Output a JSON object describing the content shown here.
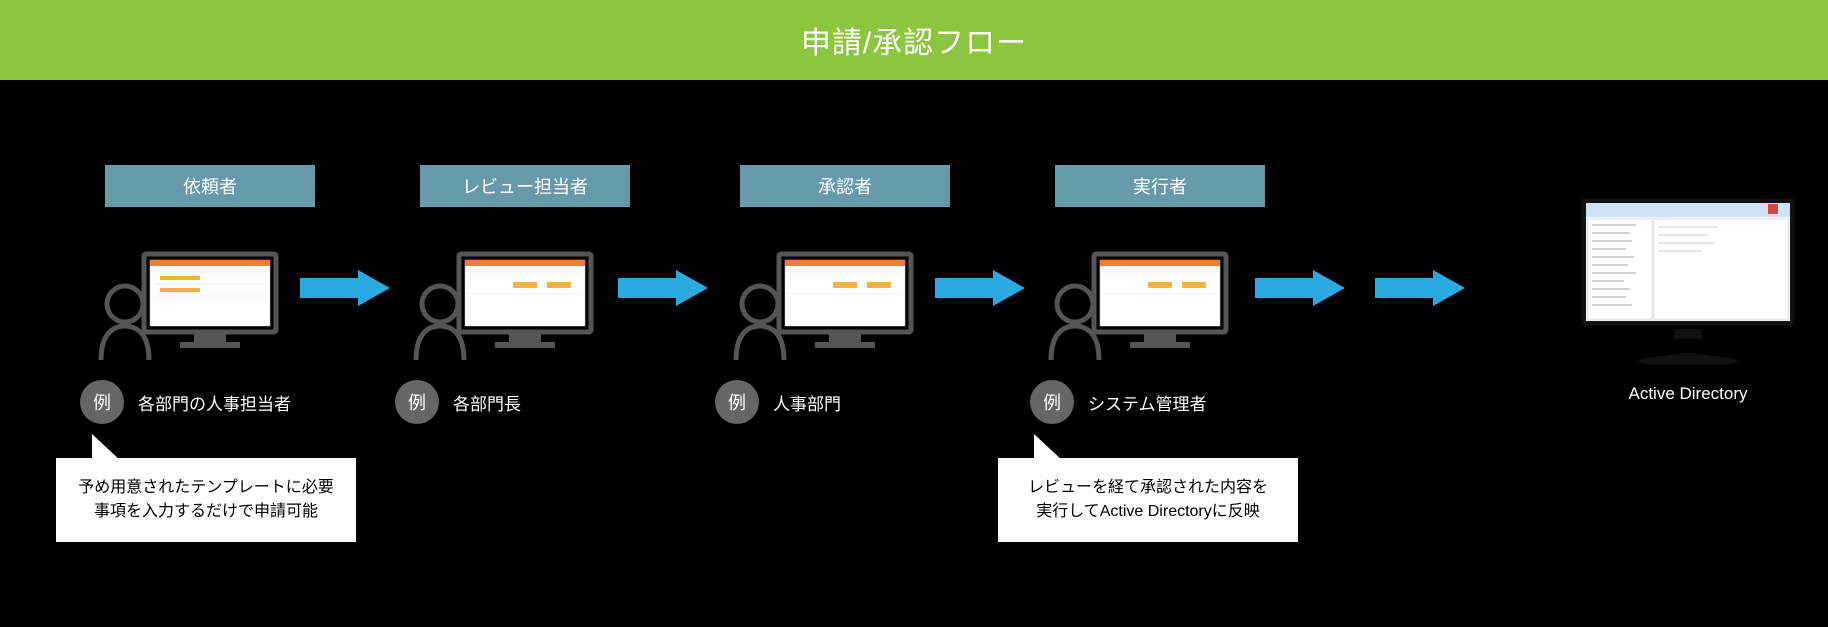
{
  "banner": {
    "title": "申請/承認フロー"
  },
  "stages": [
    {
      "role": "依頼者",
      "example_badge": "例",
      "example": "各部門の人事担当者"
    },
    {
      "role": "レビュー担当者",
      "example_badge": "例",
      "example": "各部門長"
    },
    {
      "role": "承認者",
      "example_badge": "例",
      "example": "人事部門"
    },
    {
      "role": "実行者",
      "example_badge": "例",
      "example": "システム管理者"
    }
  ],
  "callouts": {
    "left": "予め用意されたテンプレートに必要\n事項を入力するだけで申請可能",
    "right": "レビューを経て承認された内容を\n実行してActive Directoryに反映"
  },
  "final": {
    "label": "Active Directory"
  },
  "colors": {
    "banner": "#8cc63f",
    "role_box": "#6699aa",
    "arrow": "#29abe2",
    "badge": "#666"
  }
}
